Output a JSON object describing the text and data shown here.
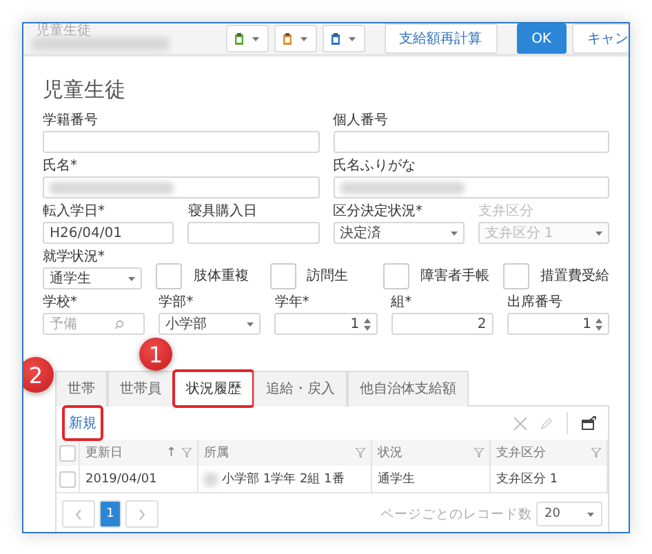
{
  "window": {
    "title": "児童生徒"
  },
  "toolbar": {
    "icon_buttons": [
      {
        "color": "#5aa832"
      },
      {
        "color": "#e08a2c"
      },
      {
        "color": "#2a6fc9"
      }
    ],
    "buttons": [
      {
        "label": "支給額再計算",
        "kind": "secondary"
      },
      {
        "label": "OK",
        "kind": "primary"
      },
      {
        "label": "キャン",
        "kind": "cut"
      }
    ]
  },
  "heading": "児童生徒",
  "form_rows": [
    [
      {
        "label": "学籍番号",
        "kind": "text"
      },
      {
        "label": "個人番号",
        "kind": "text"
      }
    ],
    [
      {
        "label": "氏名*",
        "kind": "text",
        "redacted": true
      },
      {
        "label": "氏名ふりがな",
        "kind": "text",
        "redacted": true
      }
    ],
    [
      {
        "label": "転入学日*",
        "kind": "text",
        "value": "H26/04/01"
      },
      {
        "label": "寝具購入日",
        "kind": "text"
      },
      {
        "label": "区分決定状況*",
        "kind": "select",
        "value": "決定済"
      },
      {
        "label": "支弁区分",
        "kind": "select",
        "value": "支弁区分 1",
        "disabled": true
      }
    ],
    [
      {
        "label": "就学状況*",
        "kind": "select",
        "value": "通学生"
      },
      {
        "label": "肢体重複",
        "kind": "checkbox",
        "checked": false
      },
      {
        "label": "訪問生",
        "kind": "checkbox",
        "checked": false
      },
      {
        "label": "障害者手帳",
        "kind": "checkbox",
        "checked": false
      },
      {
        "label": "措置費受給",
        "kind": "checkbox",
        "checked": false
      }
    ],
    [
      {
        "label": "学校*",
        "kind": "search",
        "placeholder": "予備"
      },
      {
        "label": "学部*",
        "kind": "select",
        "value": "小学部"
      },
      {
        "label": "学年*",
        "kind": "number",
        "value": "1",
        "spinner": true
      },
      {
        "label": "組*",
        "kind": "number",
        "value": "2",
        "spinner": false
      },
      {
        "label": "出席番号",
        "kind": "number",
        "value": "1",
        "spinner": true
      }
    ]
  ],
  "tabs": [
    {
      "label": "世帯",
      "selected": false
    },
    {
      "label": "世帯員",
      "selected": false
    },
    {
      "label": "状況履歴",
      "selected": true,
      "callout": "1"
    },
    {
      "label": "追給・戻入",
      "selected": false
    },
    {
      "label": "他自治体支給額",
      "selected": false
    }
  ],
  "panel": {
    "new_link": {
      "label": "新規",
      "callout": "2"
    },
    "table": {
      "select_all_checked": false,
      "columns": [
        {
          "label": "更新日",
          "sort_mark": "↑"
        },
        {
          "label": "所属"
        },
        {
          "label": "状況"
        },
        {
          "label": "支弁区分"
        }
      ],
      "rows": [
        {
          "checked": false,
          "cells": [
            {
              "text": "2019/04/01"
            },
            {
              "text": "小学部 1学年 2組 1番",
              "redacted_prefix": true
            },
            {
              "text": "通学生"
            },
            {
              "text": "支弁区分 1"
            }
          ]
        }
      ]
    },
    "pager": {
      "pages": [
        {
          "label": "1",
          "selected": true
        }
      ],
      "page_size_label": "ページごとのレコード数",
      "page_size": "20"
    }
  }
}
